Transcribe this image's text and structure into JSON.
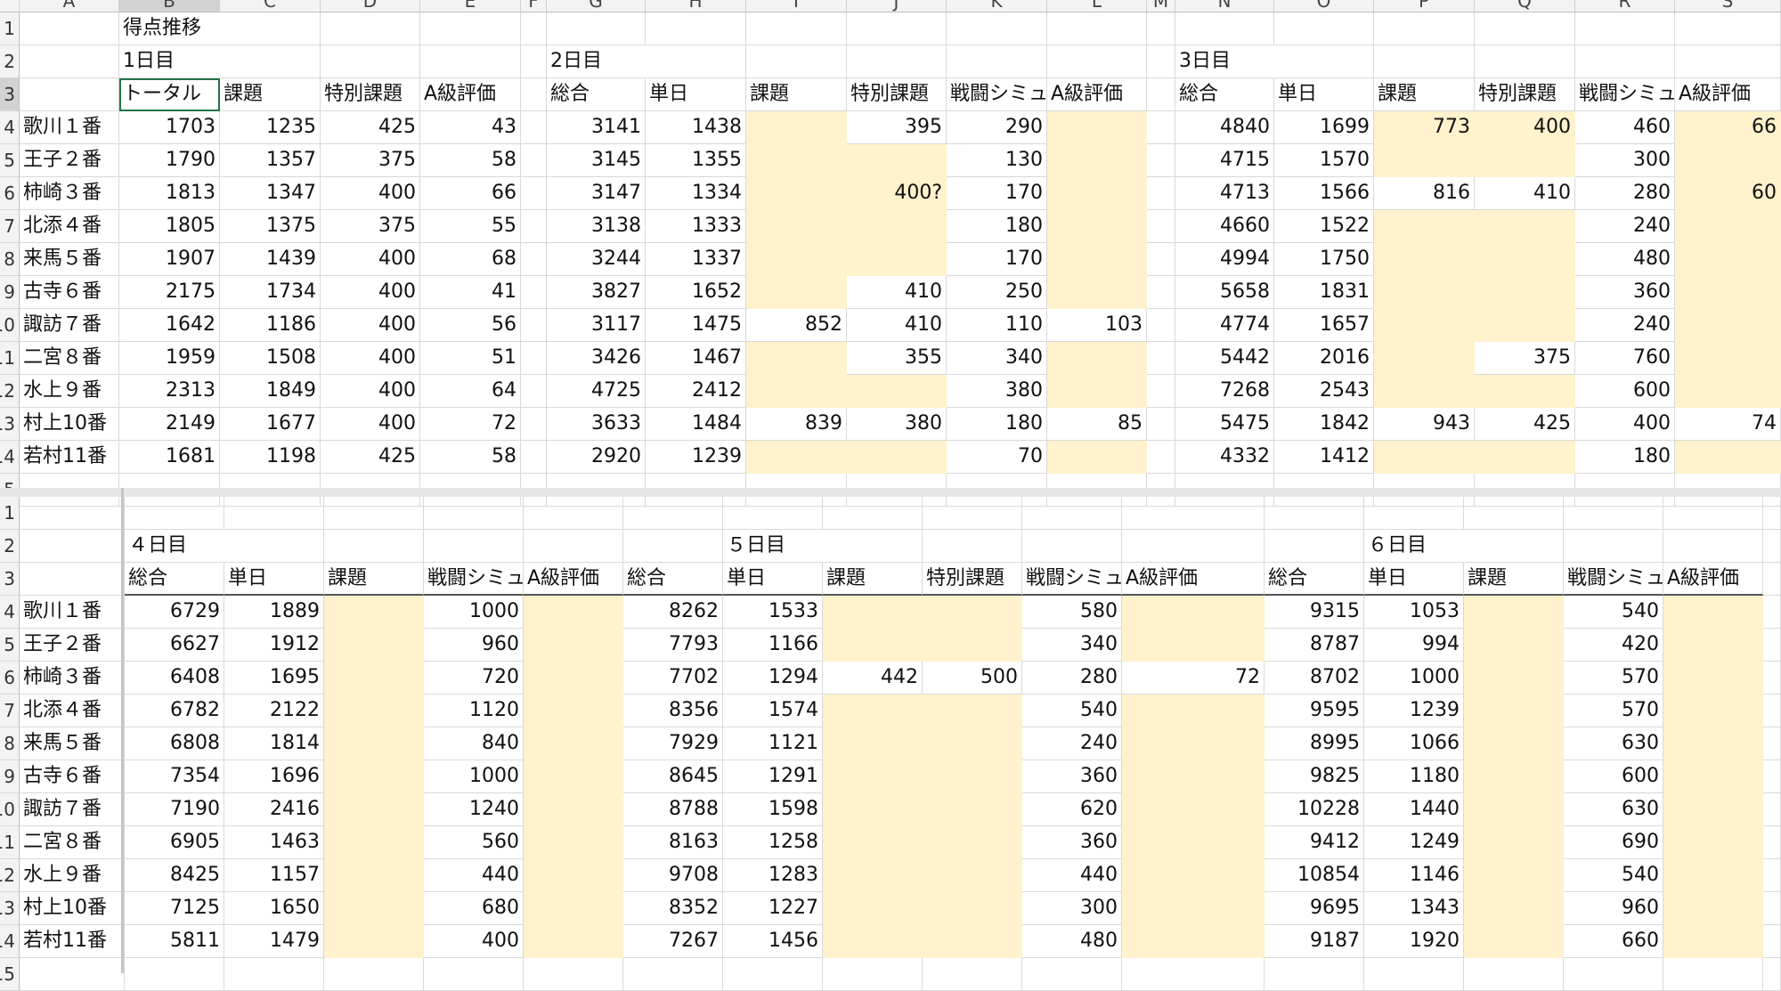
{
  "columns": [
    "A",
    "B",
    "C",
    "D",
    "E",
    "F",
    "G",
    "H",
    "I",
    "J",
    "K",
    "L",
    "M",
    "N",
    "O",
    "P",
    "Q",
    "R",
    "S"
  ],
  "rows": [
    "1",
    "2",
    "3",
    "4",
    "5",
    "6",
    "7",
    "8",
    "9",
    "10",
    "11",
    "12",
    "13",
    "14",
    "15"
  ],
  "top": {
    "title": "得点推移",
    "day_labels": [
      "1日目",
      "2日目",
      "3日目"
    ],
    "headers": [
      "トータル",
      "課題",
      "特別課題",
      "A級評価",
      "総合",
      "単日",
      "課題",
      "特別課題",
      "戦闘シミュ",
      "A級評価",
      "総合",
      "単日",
      "課題",
      "特別課題",
      "戦闘シミュ",
      "A級評価"
    ],
    "names": [
      "歌川１番",
      "王子２番",
      "柿崎３番",
      "北添４番",
      "来馬５番",
      "古寺６番",
      "諏訪７番",
      "二宮８番",
      "水上９番",
      "村上10番",
      "若村11番"
    ],
    "data": [
      [
        "1703",
        "1235",
        "425",
        "43",
        "3141",
        "1438",
        "",
        "395",
        "290",
        "",
        "4840",
        "1699",
        "773",
        "400",
        "460",
        "66"
      ],
      [
        "1790",
        "1357",
        "375",
        "58",
        "3145",
        "1355",
        "",
        "",
        "130",
        "",
        "4715",
        "1570",
        "",
        "",
        "300",
        ""
      ],
      [
        "1813",
        "1347",
        "400",
        "66",
        "3147",
        "1334",
        "",
        "400?",
        "170",
        "",
        "4713",
        "1566",
        "816",
        "410",
        "280",
        "60"
      ],
      [
        "1805",
        "1375",
        "375",
        "55",
        "3138",
        "1333",
        "",
        "",
        "180",
        "",
        "4660",
        "1522",
        "",
        "",
        "240",
        ""
      ],
      [
        "1907",
        "1439",
        "400",
        "68",
        "3244",
        "1337",
        "",
        "",
        "170",
        "",
        "4994",
        "1750",
        "",
        "",
        "480",
        ""
      ],
      [
        "2175",
        "1734",
        "400",
        "41",
        "3827",
        "1652",
        "",
        "410",
        "250",
        "",
        "5658",
        "1831",
        "",
        "",
        "360",
        ""
      ],
      [
        "1642",
        "1186",
        "400",
        "56",
        "3117",
        "1475",
        "852",
        "410",
        "110",
        "103",
        "4774",
        "1657",
        "",
        "",
        "240",
        ""
      ],
      [
        "1959",
        "1508",
        "400",
        "51",
        "3426",
        "1467",
        "",
        "355",
        "340",
        "",
        "5442",
        "2016",
        "",
        "375",
        "760",
        ""
      ],
      [
        "2313",
        "1849",
        "400",
        "64",
        "4725",
        "2412",
        "",
        "",
        "380",
        "",
        "7268",
        "2543",
        "",
        "",
        "600",
        ""
      ],
      [
        "2149",
        "1677",
        "400",
        "72",
        "3633",
        "1484",
        "839",
        "380",
        "180",
        "85",
        "5475",
        "1842",
        "943",
        "425",
        "400",
        "74"
      ],
      [
        "1681",
        "1198",
        "425",
        "58",
        "2920",
        "1239",
        "",
        "",
        "70",
        "",
        "4332",
        "1412",
        "",
        "",
        "180",
        ""
      ]
    ]
  },
  "bottom": {
    "day_labels": [
      "４日目",
      "５日目",
      "６日目"
    ],
    "headers": [
      "総合",
      "単日",
      "課題",
      "戦闘シミュ",
      "A級評価",
      "総合",
      "単日",
      "課題",
      "特別課題",
      "戦闘シミュ",
      "A級評価",
      "総合",
      "単日",
      "課題",
      "戦闘シミュ",
      "A級評価"
    ],
    "names": [
      "歌川１番",
      "王子２番",
      "柿崎３番",
      "北添４番",
      "来馬５番",
      "古寺６番",
      "諏訪７番",
      "二宮８番",
      "水上９番",
      "村上10番",
      "若村11番"
    ],
    "data": [
      [
        "6729",
        "1889",
        "",
        "1000",
        "",
        "8262",
        "1533",
        "",
        "",
        "580",
        "",
        "9315",
        "1053",
        "",
        "540",
        ""
      ],
      [
        "6627",
        "1912",
        "",
        "960",
        "",
        "7793",
        "1166",
        "",
        "",
        "340",
        "",
        "8787",
        "994",
        "",
        "420",
        ""
      ],
      [
        "6408",
        "1695",
        "",
        "720",
        "",
        "7702",
        "1294",
        "442",
        "500",
        "280",
        "72",
        "8702",
        "1000",
        "",
        "570",
        ""
      ],
      [
        "6782",
        "2122",
        "",
        "1120",
        "",
        "8356",
        "1574",
        "",
        "",
        "540",
        "",
        "9595",
        "1239",
        "",
        "570",
        ""
      ],
      [
        "6808",
        "1814",
        "",
        "840",
        "",
        "7929",
        "1121",
        "",
        "",
        "240",
        "",
        "8995",
        "1066",
        "",
        "630",
        ""
      ],
      [
        "7354",
        "1696",
        "",
        "1000",
        "",
        "8645",
        "1291",
        "",
        "",
        "360",
        "",
        "9825",
        "1180",
        "",
        "600",
        ""
      ],
      [
        "7190",
        "2416",
        "",
        "1240",
        "",
        "8788",
        "1598",
        "",
        "",
        "620",
        "",
        "10228",
        "1440",
        "",
        "630",
        ""
      ],
      [
        "6905",
        "1463",
        "",
        "560",
        "",
        "8163",
        "1258",
        "",
        "",
        "360",
        "",
        "9412",
        "1249",
        "",
        "690",
        ""
      ],
      [
        "8425",
        "1157",
        "",
        "440",
        "",
        "9708",
        "1283",
        "",
        "",
        "440",
        "",
        "10854",
        "1146",
        "",
        "540",
        ""
      ],
      [
        "7125",
        "1650",
        "",
        "680",
        "",
        "8352",
        "1227",
        "",
        "",
        "300",
        "",
        "9695",
        "1343",
        "",
        "960",
        ""
      ],
      [
        "5811",
        "1479",
        "",
        "400",
        "",
        "7267",
        "1456",
        "",
        "",
        "480",
        "",
        "9187",
        "1920",
        "",
        "660",
        ""
      ]
    ]
  }
}
